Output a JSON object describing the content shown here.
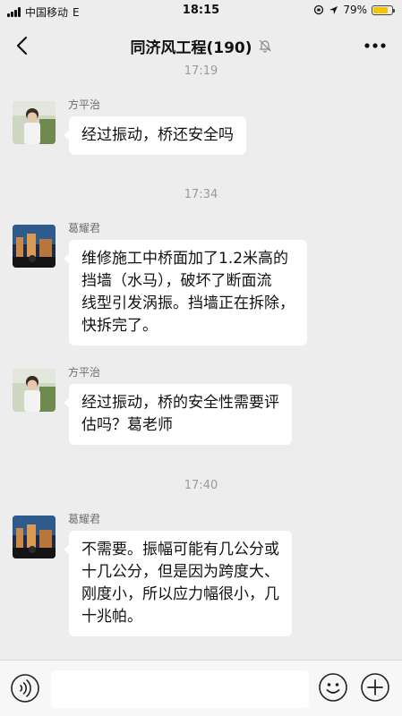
{
  "status_bar": {
    "carrier": "中国移动",
    "network": "E",
    "time": "18:15",
    "battery": "79%"
  },
  "header": {
    "title": "同济风工程(190)"
  },
  "messages": [
    {
      "type": "timestamp",
      "text": "17:19"
    },
    {
      "type": "message",
      "sender": "方平治",
      "lines": [
        "经过振动，桥还安全吗"
      ]
    },
    {
      "type": "timestamp",
      "text": "17:34"
    },
    {
      "type": "message",
      "sender": "葛耀君",
      "lines": [
        "维修施工中桥面加了1.2米高的",
        "挡墙（水马），破坏了断面流",
        "线型引发涡振。挡墙正在拆除，",
        "快拆完了。"
      ]
    },
    {
      "type": "message",
      "sender": "方平治",
      "lines": [
        "经过振动，桥的安全性需要评",
        "估吗？葛老师"
      ]
    },
    {
      "type": "timestamp",
      "text": "17:40"
    },
    {
      "type": "message",
      "sender": "葛耀君",
      "lines": [
        "不需要。振幅可能有几公分或",
        "十几公分，但是因为跨度大、",
        "刚度小，所以应力幅很小，几",
        "十兆帕。"
      ]
    }
  ],
  "input": {
    "value": "",
    "placeholder": ""
  },
  "colors": {
    "background": "#ededed",
    "bubble": "#ffffff",
    "timestamp": "#9a9a9a",
    "battery": "#f4c400"
  }
}
